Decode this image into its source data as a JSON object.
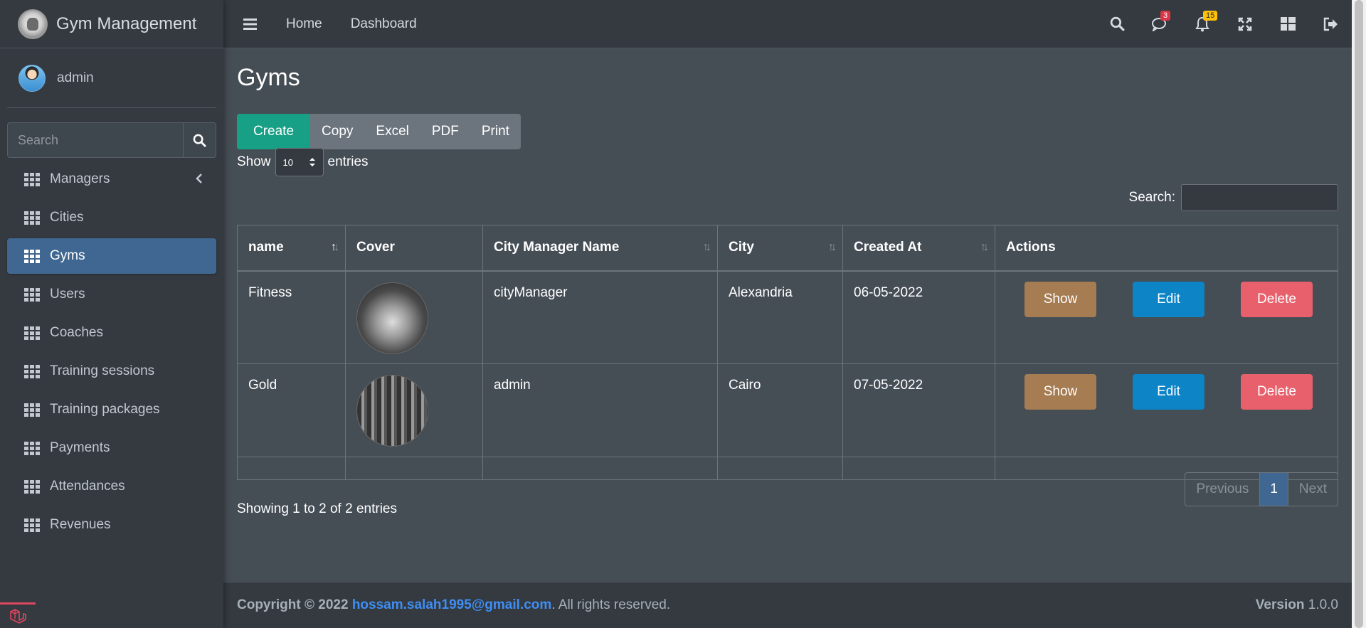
{
  "brand": {
    "title": "Gym Management"
  },
  "user": {
    "name": "admin"
  },
  "sidebar": {
    "search_placeholder": "Search",
    "items": [
      {
        "label": "Managers",
        "active": false
      },
      {
        "label": "Cities",
        "active": false
      },
      {
        "label": "Gyms",
        "active": true
      },
      {
        "label": "Users",
        "active": false
      },
      {
        "label": "Coaches",
        "active": false
      },
      {
        "label": "Training sessions",
        "active": false
      },
      {
        "label": "Training packages",
        "active": false
      },
      {
        "label": "Payments",
        "active": false
      },
      {
        "label": "Attendances",
        "active": false
      },
      {
        "label": "Revenues",
        "active": false
      }
    ]
  },
  "topnav": {
    "links": [
      "Home",
      "Dashboard"
    ],
    "messages_count": "3",
    "notifications_count": "15",
    "icons": [
      "search-icon",
      "comments-icon",
      "bell-icon",
      "expand-icon",
      "th-large-icon",
      "sign-out-icon"
    ]
  },
  "page": {
    "title": "Gyms",
    "buttons": [
      "Create",
      "Copy",
      "Excel",
      "PDF",
      "Print"
    ],
    "show_label": "Show",
    "entries_label": "entries",
    "page_length": "10",
    "search_label": "Search:",
    "search_value": ""
  },
  "table": {
    "headers": [
      "name",
      "Cover",
      "City Manager Name",
      "City",
      "Created At",
      "Actions"
    ],
    "rows": [
      {
        "name": "Fitness",
        "manager": "cityManager",
        "city": "Alexandria",
        "created": "06-05-2022"
      },
      {
        "name": "Gold",
        "manager": "admin",
        "city": "Cairo",
        "created": "07-05-2022"
      }
    ],
    "actions": {
      "show": "Show",
      "edit": "Edit",
      "delete": "Delete"
    }
  },
  "info": "Showing 1 to 2 of 2 entries",
  "pagination": {
    "previous": "Previous",
    "current": "1",
    "next": "Next"
  },
  "footer": {
    "copyright": "Copyright © 2022",
    "email": "hossam.salah1995@gmail.com",
    "rights": ". All rights reserved.",
    "version_label": "Version",
    "version": "1.0.0"
  },
  "colors": {
    "sidebar_bg": "#343a40",
    "content_bg": "#454d55",
    "active_nav": "#3f6791",
    "create_button": "#17a085",
    "show_button": "#a67c52",
    "edit_button": "#0c84c6",
    "delete_button": "#e8606c"
  }
}
